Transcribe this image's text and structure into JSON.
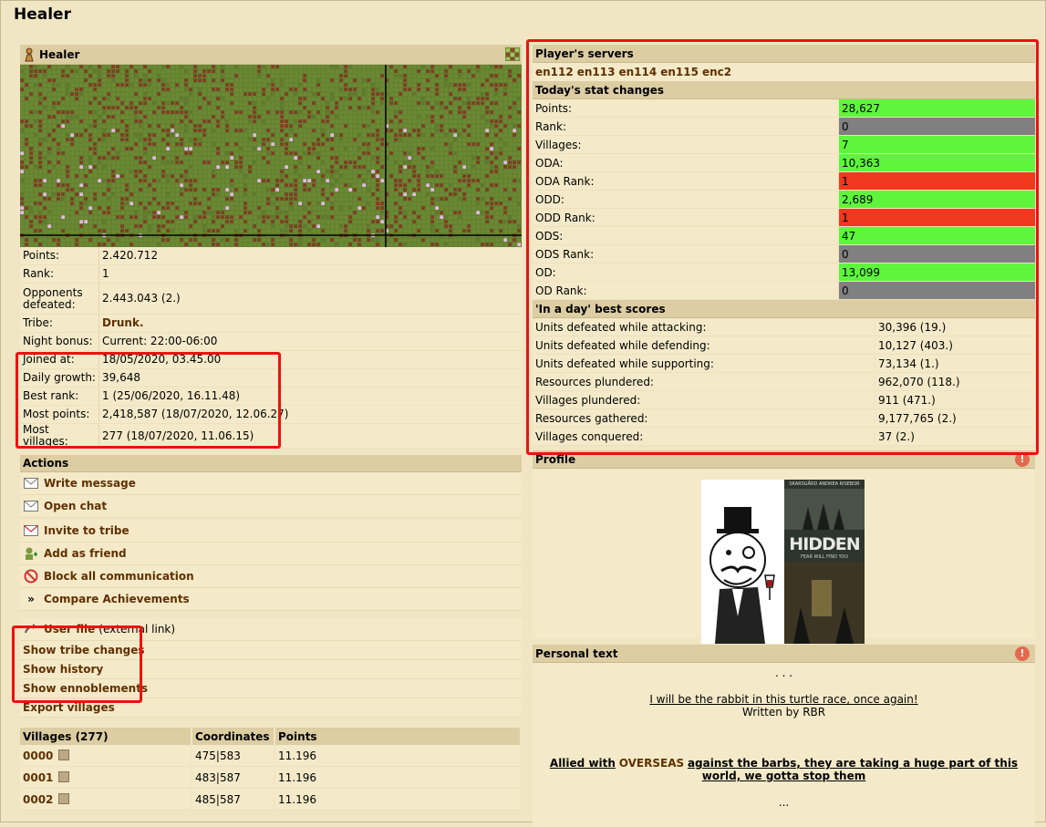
{
  "title": "Healer",
  "player_panel": {
    "name": "Healer"
  },
  "info": [
    {
      "label": "Points:",
      "value": "2.420.712"
    },
    {
      "label": "Rank:",
      "value": "1"
    },
    {
      "label": "Opponents defeated:",
      "value": "2.443.043 (2.)"
    },
    {
      "label": "Tribe:",
      "value": "Drunk."
    },
    {
      "label": "Night bonus:",
      "value": "Current: 22:00-06:00"
    },
    {
      "label": "Joined at:",
      "value": "18/05/2020, 03.45.00"
    },
    {
      "label": "Daily growth:",
      "value": "39,648"
    },
    {
      "label": "Best rank:",
      "value": "1 (25/06/2020, 16.11.48)"
    },
    {
      "label": "Most points:",
      "value": "2,418,587 (18/07/2020, 12.06.27)"
    },
    {
      "label": "Most villages:",
      "value": "277 (18/07/2020, 11.06.15)"
    }
  ],
  "actions": {
    "header": "Actions",
    "items": [
      {
        "label": "Write message",
        "icon": "envelope-icon"
      },
      {
        "label": "Open chat",
        "icon": "envelope-icon"
      },
      {
        "label": "Invite to tribe",
        "icon": "invite-icon"
      },
      {
        "label": "Add as friend",
        "icon": "add-friend-icon"
      },
      {
        "label": "Block all communication",
        "icon": "block-icon"
      },
      {
        "label": "Compare Achievements",
        "icon": "double-arrow-icon"
      },
      {
        "label": "User file",
        "ext": "(external link)",
        "icon": "arrow-icon"
      },
      {
        "label": "Show tribe changes"
      },
      {
        "label": "Show history"
      },
      {
        "label": "Show ennoblements"
      },
      {
        "label": "Export villages"
      }
    ]
  },
  "villages": {
    "headers": [
      "Villages (277)",
      "Coordinates",
      "Points"
    ],
    "rows": [
      {
        "name": "0000",
        "coords": "475|583",
        "points": "11.196"
      },
      {
        "name": "0001",
        "coords": "483|587",
        "points": "11.196"
      },
      {
        "name": "0002",
        "coords": "485|587",
        "points": "11.196"
      }
    ]
  },
  "servers": {
    "header": "Player's servers",
    "list": [
      "en112",
      "en113",
      "en114",
      "en115",
      "enc2"
    ]
  },
  "today": {
    "header": "Today's stat changes",
    "rows": [
      {
        "label": "Points:",
        "value": "28,627",
        "color": "#5ef53c"
      },
      {
        "label": "Rank:",
        "value": "0",
        "color": "#808080"
      },
      {
        "label": "Villages:",
        "value": "7",
        "color": "#5ef53c"
      },
      {
        "label": "ODA:",
        "value": "10,363",
        "color": "#5ef53c"
      },
      {
        "label": "ODA Rank:",
        "value": "1",
        "color": "#f0381f"
      },
      {
        "label": "ODD:",
        "value": "2,689",
        "color": "#5ef53c"
      },
      {
        "label": "ODD Rank:",
        "value": "1",
        "color": "#f0381f"
      },
      {
        "label": "ODS:",
        "value": "47",
        "color": "#5ef53c"
      },
      {
        "label": "ODS Rank:",
        "value": "0",
        "color": "#808080"
      },
      {
        "label": "OD:",
        "value": "13,099",
        "color": "#5ef53c"
      },
      {
        "label": "OD Rank:",
        "value": "0",
        "color": "#808080"
      }
    ]
  },
  "best": {
    "header": "'In a day' best scores",
    "rows": [
      {
        "label": "Units defeated while attacking:",
        "value": "30,396 (19.)"
      },
      {
        "label": "Units defeated while defending:",
        "value": "10,127 (403.)"
      },
      {
        "label": "Units defeated while supporting:",
        "value": "73,134 (1.)"
      },
      {
        "label": "Resources plundered:",
        "value": "962,070 (118.)"
      },
      {
        "label": "Villages plundered:",
        "value": "911 (471.)"
      },
      {
        "label": "Resources gathered:",
        "value": "9,177,765 (2.)"
      },
      {
        "label": "Villages conquered:",
        "value": "37 (2.)"
      }
    ]
  },
  "profile": {
    "header": "Profile",
    "poster_top": "SKARSGÅRD   ANDREA RISEBOR",
    "poster_title": "HIDDEN",
    "poster_tagline": "FEAR WILL FIND YOU"
  },
  "personal_text": {
    "header": "Personal text",
    "dots1": ". . .",
    "link": "I will be the rabbit in this turtle race, once again!",
    "written": "Written by RBR",
    "ally_pre": "Allied with",
    "ally_name": "OVERSEAS",
    "ally_post": "against the barbs, they are taking a huge part of this world, we gotta stop them",
    "dots2": "..."
  },
  "colors": {
    "accent": "#603000",
    "green": "#5ef53c",
    "red": "#f0381f",
    "grey": "#808080",
    "highlight": "#f01010"
  }
}
